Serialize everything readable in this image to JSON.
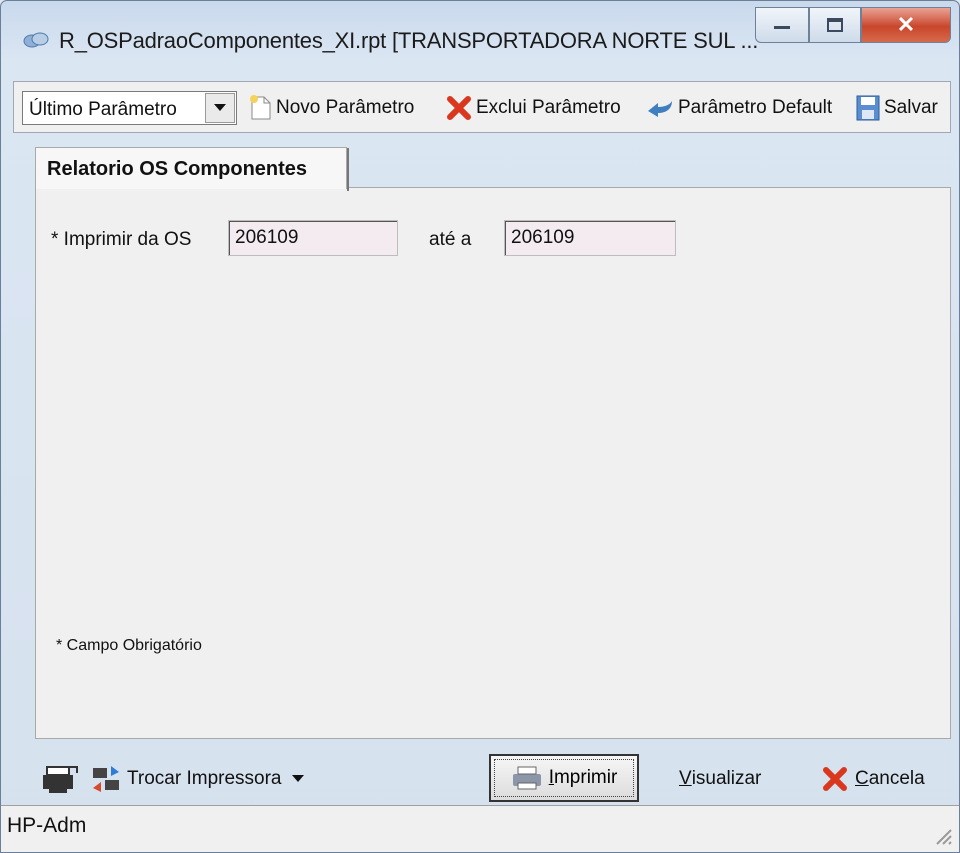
{
  "window": {
    "title": "R_OSPadraoComponentes_XI.rpt [TRANSPORTADORA NORTE SUL ...",
    "controls": [
      "minimize",
      "maximize",
      "close"
    ]
  },
  "toolbar": {
    "param_select": "Último Parâmetro",
    "novo_parametro": "Novo Parâmetro",
    "exclui_parametro": "Exclui Parâmetro",
    "parametro_default": "Parâmetro Default",
    "salvar": "Salvar"
  },
  "tab": {
    "label": "Relatorio OS Componentes"
  },
  "form": {
    "from_label": "* Imprimir da OS",
    "from_value": "206109",
    "to_label": "até a",
    "to_value": "206109",
    "required_note": "* Campo Obrigatório"
  },
  "bottom": {
    "trocar_impressora": "Trocar Impressora",
    "imprimir_prefix": "I",
    "imprimir_rest": "mprimir",
    "visualizar_prefix": "V",
    "visualizar_rest": "isualizar",
    "cancela_prefix": "C",
    "cancela_rest": "ancela"
  },
  "status": {
    "printer": "HP-Adm"
  },
  "colors": {
    "close_button": "#c9462c",
    "field_bg": "#f3ebf0",
    "cancel_x": "#d9381e"
  }
}
